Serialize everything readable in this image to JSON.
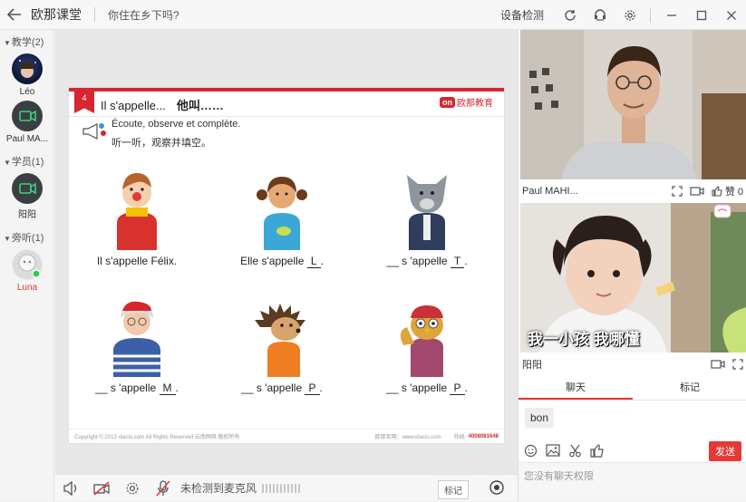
{
  "titlebar": {
    "app_name": "欧那课堂",
    "course_title": "你住在乡下吗?",
    "device_check": "设备检测"
  },
  "sidebar": {
    "teachers_label": "教学(2)",
    "students_label": "学员(1)",
    "auditors_label": "旁听(1)",
    "teachers": [
      {
        "name": "Léo"
      },
      {
        "name": "Paul MA..."
      }
    ],
    "students": [
      {
        "name": "阳阳"
      }
    ],
    "auditors": [
      {
        "name": "Luna"
      }
    ]
  },
  "slide": {
    "number": "4",
    "title_fr": "Il s'appelle...",
    "title_zh": "他叫……",
    "logo_text": "欧那教育",
    "logo_mark": "on",
    "instruction_fr": "Écoute, observe et complète.",
    "instruction_zh": "听一听，观察并填空。",
    "captions": [
      {
        "prefix": "Il s'appelle Félix.",
        "blank": "",
        "suffix": ""
      },
      {
        "prefix": "Elle s'appelle ",
        "blank": "L",
        "suffix": "."
      },
      {
        "prefix": "__ s 'appelle ",
        "blank": "T",
        "suffix": "."
      },
      {
        "prefix": "__ s 'appelle ",
        "blank": "M",
        "suffix": "."
      },
      {
        "prefix": "__ s 'appelle ",
        "blank": "P",
        "suffix": "."
      },
      {
        "prefix": "__ s 'appelle ",
        "blank": "P",
        "suffix": "."
      }
    ],
    "footer_left": "Copyright © 2013 olacio.com All Rights Reserved 云南网络 版权所有",
    "footer_mid": "欧那官网：www.olacio.com",
    "footer_phone_label": "热线",
    "footer_phone": "4008081648"
  },
  "bottombar": {
    "mic_status": "未检测到麦克风",
    "mark_label": "标记"
  },
  "right": {
    "teacher_video_name": "Paul MAHI...",
    "likes": "赞 0",
    "student_video_name": "阳阳",
    "student_subtitle": "我一小孩 我哪懂",
    "tab_chat": "聊天",
    "tab_mark": "标记",
    "chat_messages": [
      "bon"
    ],
    "send_label": "发送",
    "no_permission": "您没有聊天权限"
  },
  "colors": {
    "accent": "#e53935",
    "slide_red": "#d7262e"
  }
}
